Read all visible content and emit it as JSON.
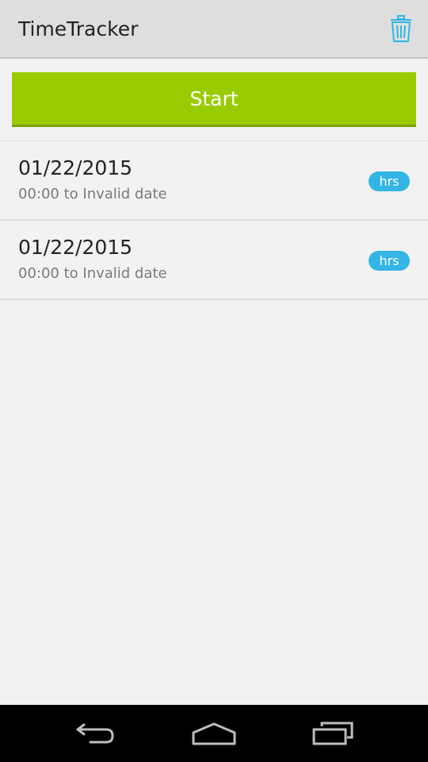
{
  "action_bar": {
    "title": "TimeTracker",
    "trash_icon": "trash-icon",
    "icon_color": "#33b5e5",
    "background": "#dedede"
  },
  "start_button": {
    "label": "Start",
    "color": "#99cc00"
  },
  "entries": [
    {
      "date": "01/22/2015",
      "range": "00:00 to Invalid date",
      "badge": "hrs"
    },
    {
      "date": "01/22/2015",
      "range": "00:00 to Invalid date",
      "badge": "hrs"
    }
  ],
  "badge_color": "#33b5e5",
  "nav_bar": {
    "buttons": [
      "back-icon",
      "home-icon",
      "recents-icon"
    ]
  }
}
